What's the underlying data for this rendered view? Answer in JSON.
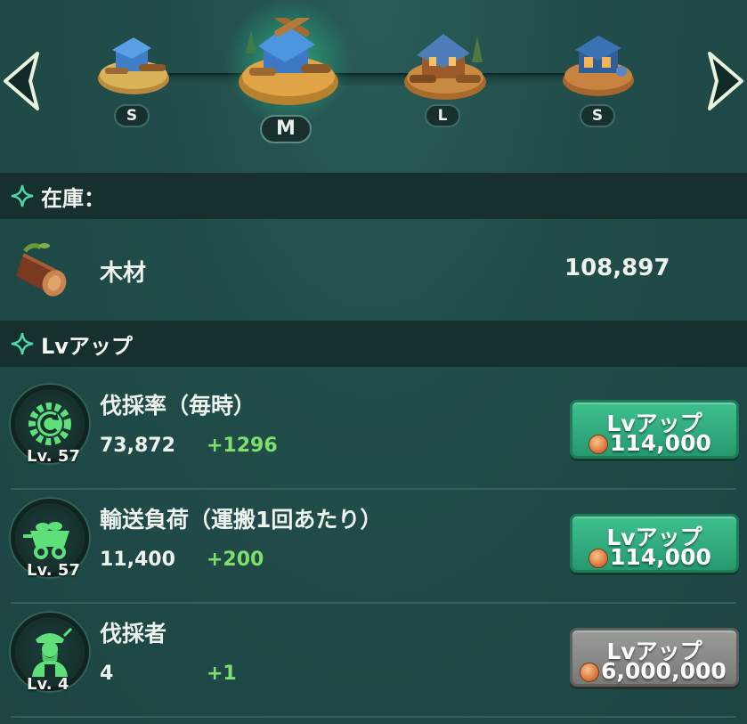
{
  "carousel": {
    "buildings": [
      {
        "size": "S",
        "active": false
      },
      {
        "size": "M",
        "active": true
      },
      {
        "size": "L",
        "active": false
      },
      {
        "size": "S",
        "active": false
      }
    ]
  },
  "inventory": {
    "header": "在庫：",
    "item": {
      "name": "木材",
      "amount": "108,897",
      "icon": "log-icon"
    }
  },
  "levelup": {
    "header": "Lvアップ",
    "rows": [
      {
        "name": "伐採率（毎時）",
        "level": "Lv. 57",
        "value": "73,872",
        "delta": "+1296",
        "button": "Lvアップ",
        "cost": "114,000",
        "enabled": true,
        "icon": "gear-icon"
      },
      {
        "name": "輸送負荷（運搬1回あたり）",
        "level": "Lv. 57",
        "value": "11,400",
        "delta": "+200",
        "button": "Lvアップ",
        "cost": "114,000",
        "enabled": true,
        "icon": "cart-icon"
      },
      {
        "name": "伐採者",
        "level": "Lv. 4",
        "value": "4",
        "delta": "+1",
        "button": "Lvアップ",
        "cost": "6,000,000",
        "enabled": false,
        "icon": "lumberjack-icon"
      }
    ]
  },
  "colors": {
    "accent_green": "#3fc08e",
    "delta_green": "#7ee06a",
    "disabled_gray": "#8a8c88",
    "header_bg": "#15302f"
  }
}
